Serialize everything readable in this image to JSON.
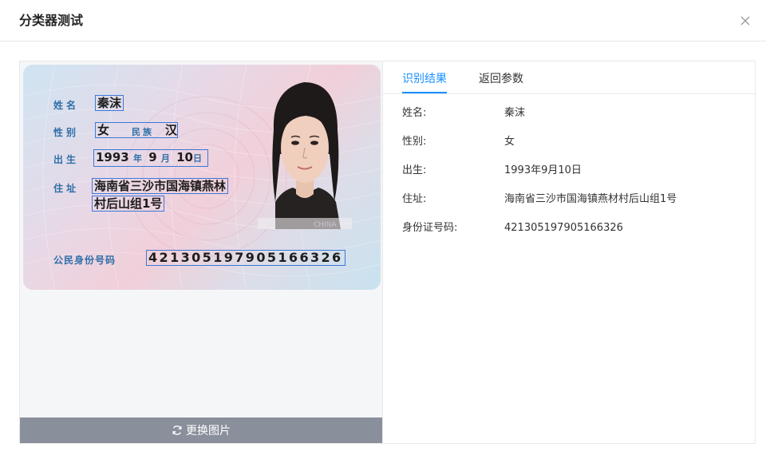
{
  "dialog": {
    "title": "分类器测试"
  },
  "icons": {
    "close": "close-icon",
    "refresh": "refresh-icon"
  },
  "card": {
    "labels": {
      "name": "姓名",
      "gender": "性别",
      "ethnicity": "民族",
      "birth": "出生",
      "birth_year_unit": "年",
      "birth_month_unit": "月",
      "address": "住址",
      "id_number": "公民身份号码"
    },
    "values": {
      "name": "秦沫",
      "gender": "女",
      "ethnicity": "汉",
      "birth_year": "1993",
      "birth_month": "9",
      "birth_day": "10",
      "birth_day_unit": "日",
      "address_line1": "海南省三沙市国海镇燕林",
      "address_line2": "村后山组1号",
      "id_number": "421305197905166326"
    },
    "watermark": "CHINA"
  },
  "change_image_label": "更换图片",
  "tabs": [
    {
      "label": "识别结果",
      "active": true
    },
    {
      "label": "返回参数",
      "active": false
    }
  ],
  "results": [
    {
      "label": "姓名:",
      "value": "秦沫"
    },
    {
      "label": "性别:",
      "value": "女"
    },
    {
      "label": "出生:",
      "value": "1993年9月10日"
    },
    {
      "label": "住址:",
      "value": "海南省三沙市国海镇燕材村后山组1号"
    },
    {
      "label": "身份证号码:",
      "value": "421305197905166326"
    }
  ],
  "colors": {
    "accent": "#1890ff",
    "box": "#3b78d8",
    "bar": "#8a8f9c"
  }
}
